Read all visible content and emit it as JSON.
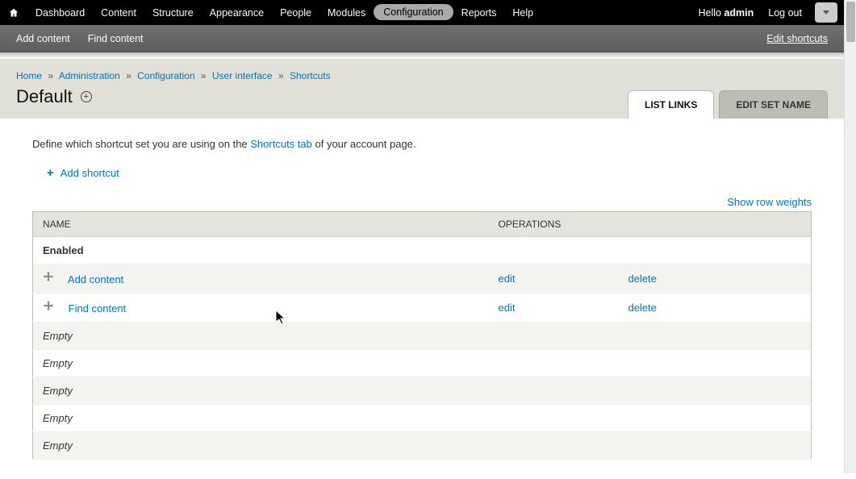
{
  "admin_menu": {
    "items": [
      {
        "label": "Dashboard"
      },
      {
        "label": "Content"
      },
      {
        "label": "Structure"
      },
      {
        "label": "Appearance"
      },
      {
        "label": "People"
      },
      {
        "label": "Modules"
      },
      {
        "label": "Configuration",
        "active": true
      },
      {
        "label": "Reports"
      },
      {
        "label": "Help"
      }
    ],
    "hello_prefix": "Hello ",
    "username": "admin",
    "logout": "Log out"
  },
  "shortcut_bar": {
    "items": [
      {
        "label": "Add content"
      },
      {
        "label": "Find content"
      }
    ],
    "edit_link": "Edit shortcuts"
  },
  "breadcrumb": [
    {
      "label": "Home"
    },
    {
      "label": "Administration"
    },
    {
      "label": "Configuration"
    },
    {
      "label": "User interface"
    },
    {
      "label": "Shortcuts"
    }
  ],
  "page_title": "Default",
  "tabs": [
    {
      "label": "LIST LINKS",
      "active": true
    },
    {
      "label": "EDIT SET NAME",
      "active": false
    }
  ],
  "intro": {
    "before": "Define which shortcut set you are using on the ",
    "link": "Shortcuts tab",
    "after": " of your account page."
  },
  "add_shortcut_label": "Add shortcut",
  "show_row_weights": "Show row weights",
  "table": {
    "headers": [
      "NAME",
      "OPERATIONS"
    ],
    "section_enabled": "Enabled",
    "rows": [
      {
        "name": "Add content",
        "edit": "edit",
        "delete": "delete"
      },
      {
        "name": "Find content",
        "edit": "edit",
        "delete": "delete"
      }
    ],
    "empty_label": "Empty",
    "empty_rows": 5
  }
}
